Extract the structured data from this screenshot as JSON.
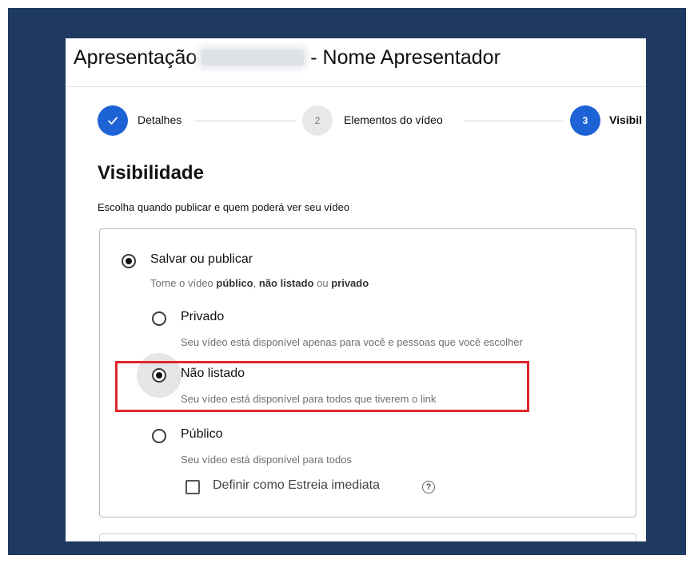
{
  "header": {
    "title_prefix": "Apresentação",
    "title_suffix": "- Nome Apresentador"
  },
  "stepper": {
    "steps": [
      {
        "number": "",
        "label": "Detalhes",
        "state": "done",
        "icon": "check-icon"
      },
      {
        "number": "2",
        "label": "Elementos do vídeo",
        "state": "pending"
      },
      {
        "number": "3",
        "label": "Visibil",
        "state": "active"
      }
    ]
  },
  "visibility": {
    "title": "Visibilidade",
    "subtitle": "Escolha quando publicar e quem poderá ver seu vídeo",
    "save_publish": {
      "label": "Salvar ou publicar",
      "desc_prefix": "Torne o vídeo",
      "desc_public": "público",
      "desc_unlisted": "não listado",
      "desc_or": "ou",
      "desc_private": "privado",
      "comma": ","
    },
    "options": [
      {
        "label": "Privado",
        "desc": "Seu vídeo está disponível apenas para você e pessoas que você escolher",
        "checked": false
      },
      {
        "label": "Não listado",
        "desc": "Seu vídeo está disponível para todos que tiverem o link",
        "checked": true
      },
      {
        "label": "Público",
        "desc": "Seu vídeo está disponível para todos",
        "checked": false
      }
    ],
    "premiere_checkbox": {
      "label": "Definir como Estreia imediata",
      "checked": false,
      "help_icon": "?"
    }
  },
  "colors": {
    "frame_background": "#1f3a60",
    "accent_blue": "#1e63d6",
    "highlight_red": "#e0262b"
  }
}
